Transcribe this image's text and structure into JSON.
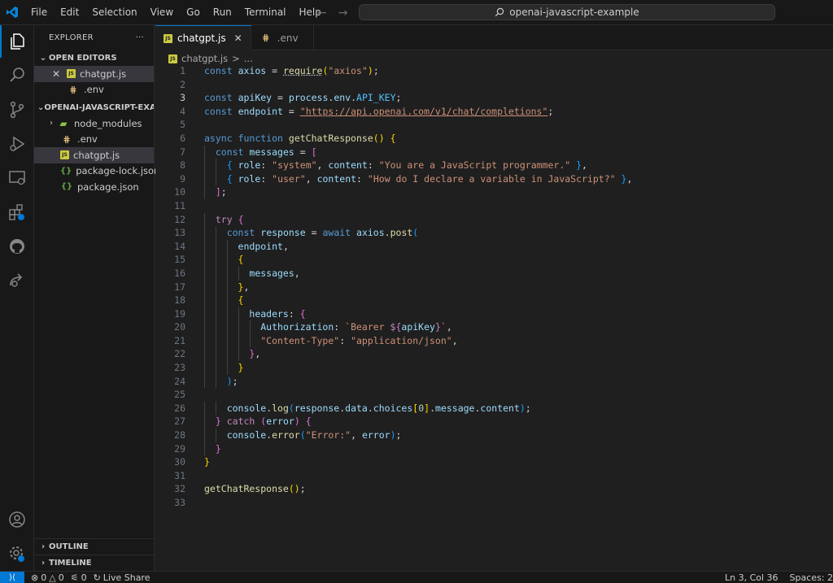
{
  "menu": [
    "File",
    "Edit",
    "Selection",
    "View",
    "Go",
    "Run",
    "Terminal",
    "Help"
  ],
  "command_center": "openai-javascript-example",
  "sidebar": {
    "title": "EXPLORER",
    "more": "···",
    "open_editors_label": "OPEN EDITORS",
    "open_editors": [
      {
        "name": "chatgpt.js",
        "icon": "js-file-icon"
      },
      {
        "name": ".env",
        "icon": "env-file-icon"
      }
    ],
    "project_label": "OPENAI-JAVASCRIPT-EXA...",
    "files": [
      {
        "name": "node_modules",
        "icon": "folder-icon"
      },
      {
        "name": ".env",
        "icon": "env-file-icon"
      },
      {
        "name": "chatgpt.js",
        "icon": "js-file-icon"
      },
      {
        "name": "package-lock.json",
        "icon": "json-file-icon"
      },
      {
        "name": "package.json",
        "icon": "json-file-icon"
      }
    ],
    "outline_label": "OUTLINE",
    "timeline_label": "TIMELINE"
  },
  "tabs": [
    {
      "name": "chatgpt.js",
      "active": true
    },
    {
      "name": ".env",
      "active": false
    }
  ],
  "breadcrumb": {
    "file": "chatgpt.js",
    "sep": ">",
    "more": "..."
  },
  "editor": {
    "current_line": 3,
    "line_numbers": [
      "1",
      "2",
      "3",
      "4",
      "5",
      "6",
      "7",
      "8",
      "9",
      "10",
      "11",
      "12",
      "13",
      "14",
      "15",
      "16",
      "17",
      "18",
      "19",
      "20",
      "21",
      "22",
      "23",
      "24",
      "25",
      "26",
      "27",
      "28",
      "29",
      "30",
      "31",
      "32",
      "33"
    ],
    "code": [
      "const axios = require(\"axios\");",
      "",
      "const apiKey = process.env.API_KEY;",
      "const endpoint = \"https://api.openai.com/v1/chat/completions\";",
      "",
      "async function getChatResponse() {",
      "  const messages = [",
      "    { role: \"system\", content: \"You are a JavaScript programmer.\" },",
      "    { role: \"user\", content: \"How do I declare a variable in JavaScript?\" },",
      "  ];",
      "",
      "  try {",
      "    const response = await axios.post(",
      "      endpoint,",
      "      {",
      "        messages,",
      "      },",
      "      {",
      "        headers: {",
      "          Authorization: `Bearer ${apiKey}`,",
      "          \"Content-Type\": \"application/json\",",
      "        },",
      "      }",
      "    );",
      "",
      "    console.log(response.data.choices[0].message.content);",
      "  } catch (error) {",
      "    console.error(\"Error:\", error);",
      "  }",
      "}",
      "",
      "getChatResponse();",
      ""
    ]
  },
  "status": {
    "errors": "0",
    "warnings": "0",
    "ports": "0",
    "live_share": "Live Share",
    "position": "Ln 3, Col 36",
    "spaces": "Spaces: 2"
  },
  "colors": {
    "accent": "#0078d4",
    "background": "#1f1f1f",
    "sidebar": "#181818"
  }
}
